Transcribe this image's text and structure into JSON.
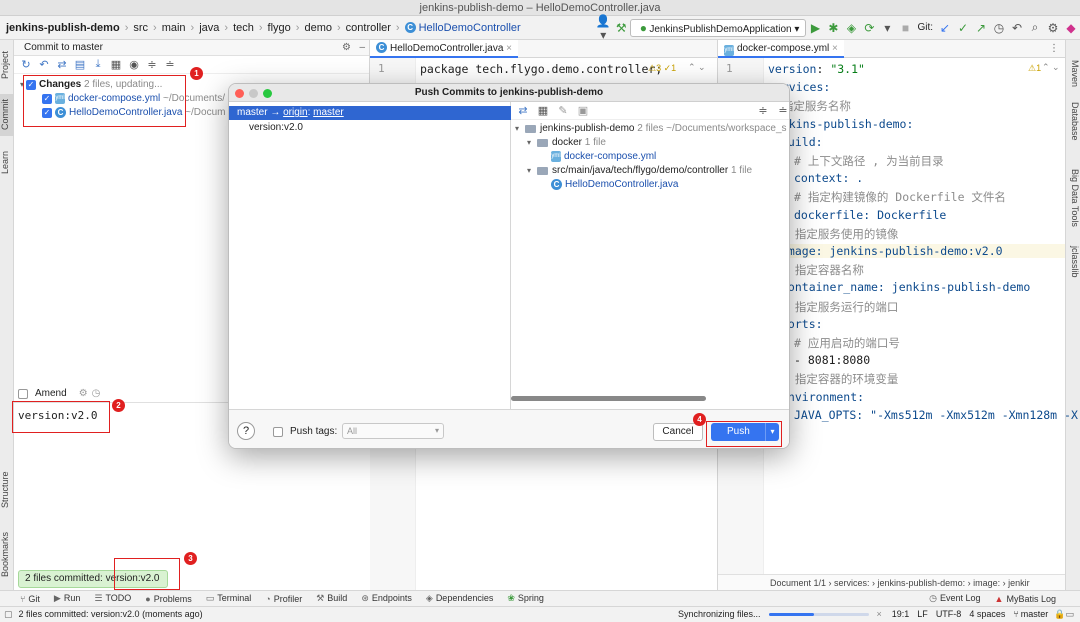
{
  "window": {
    "title": "jenkins-publish-demo – HelloDemoController.java"
  },
  "navbar": {
    "crumbs": [
      "jenkins-publish-demo",
      "src",
      "main",
      "java",
      "tech",
      "flygo",
      "demo",
      "controller",
      "HelloDemoController"
    ],
    "run_config": "JenkinsPublishDemoApplication",
    "git_label": "Git:"
  },
  "left_stripe": {
    "project": "Project",
    "commit": "Commit",
    "learn": "Learn",
    "structure": "Structure",
    "bookmarks": "Bookmarks"
  },
  "right_stripe": {
    "maven": "Maven",
    "database": "Database",
    "bigdata": "Big Data Tools",
    "jclasslib": "jclasslib"
  },
  "commit_panel": {
    "header": "Commit to master",
    "changes_label": "Changes",
    "changes_status": "2 files, updating...",
    "files": [
      {
        "name": "docker-compose.yml",
        "path": "~/Documents/"
      },
      {
        "name": "HelloDemoController.java",
        "path": "~/Docum"
      }
    ],
    "amend_label": "Amend",
    "message": "version:v2.0"
  },
  "annotations": [
    "1",
    "2",
    "3",
    "4"
  ],
  "editor1": {
    "tab": "HelloDemoController.java",
    "line_number": "1",
    "code": "package tech.flygo.demo.controller;",
    "warnings": "⚠3 ✓1"
  },
  "editor2": {
    "tab": "docker-compose.yml",
    "line_number": "1",
    "warnings": "⚠1",
    "lines": [
      {
        "k": "version",
        "v": "\"3.1\"",
        "type": "kv"
      },
      {
        "text": "services:",
        "type": "key",
        "indent": 0
      },
      {
        "text": "# 指定服务名称",
        "type": "cmt",
        "indent": 0
      },
      {
        "text": "jenkins-publish-demo:",
        "type": "key",
        "indent": 0
      },
      {
        "text": "build:",
        "type": "key",
        "indent": 1
      },
      {
        "text": "# 上下文路径 , 为当前目录",
        "type": "cmt",
        "indent": 2
      },
      {
        "text": "context: .",
        "type": "key",
        "indent": 2
      },
      {
        "text": "# 指定构建镜像的 Dockerfile 文件名",
        "type": "cmt",
        "indent": 2
      },
      {
        "text": "dockerfile: Dockerfile",
        "type": "key",
        "indent": 2
      },
      {
        "text": "# 指定服务使用的镜像",
        "type": "cmt",
        "indent": 1
      },
      {
        "text": "image: jenkins-publish-demo:v2.0",
        "type": "key",
        "indent": 1
      },
      {
        "text": "# 指定容器名称",
        "type": "cmt",
        "indent": 1
      },
      {
        "text": "container_name: jenkins-publish-demo",
        "type": "key",
        "indent": 1
      },
      {
        "text": "# 指定服务运行的端口",
        "type": "cmt",
        "indent": 1
      },
      {
        "text": "ports:",
        "type": "key",
        "indent": 1
      },
      {
        "text": "# 应用启动的端口号",
        "type": "cmt",
        "indent": 2
      },
      {
        "text": "- 8081:8080",
        "type": "plain",
        "indent": 2
      },
      {
        "text": "# 指定容器的环境变量",
        "type": "cmt",
        "indent": 1
      },
      {
        "text": "environment:",
        "type": "key",
        "indent": 1
      },
      {
        "text": "JAVA_OPTS: \"-Xms512m -Xmx512m -Xmn128m -X",
        "type": "key",
        "indent": 2
      }
    ],
    "breadcrumb": "Document 1/1  ›  services:  ›  jenkins-publish-demo:  ›  image:  ›  jenkir"
  },
  "dialog": {
    "title": "Push Commits to jenkins-publish-demo",
    "branch_row": {
      "local": "master",
      "arrow": "→",
      "remote": "origin",
      "colon": ":",
      "target": "master"
    },
    "commit": "version:v2.0",
    "tree": {
      "root": {
        "name": "jenkins-publish-demo",
        "meta": "2 files ~/Documents/workspace_s"
      },
      "folder1": {
        "name": "docker",
        "meta": "1 file"
      },
      "file1": "docker-compose.yml",
      "folder2": {
        "name": "src/main/java/tech/flygo/demo/controller",
        "meta": "1 file"
      },
      "file2": "HelloDemoController.java"
    },
    "help": "?",
    "push_tags_label": "Push tags:",
    "tags_value": "All",
    "cancel": "Cancel",
    "push": "Push"
  },
  "toast": {
    "text": "2 files committed: version:v2.0"
  },
  "bottom_tools": [
    "Git",
    "Run",
    "TODO",
    "Problems",
    "Terminal",
    "Profiler",
    "Build",
    "Endpoints",
    "Dependencies",
    "Spring"
  ],
  "bottom_right_tools": [
    "Event Log",
    "MyBatis Log"
  ],
  "statusbar": {
    "message": "2 files committed: version:v2.0 (moments ago)",
    "task": "Synchronizing files...",
    "progress": 0.45,
    "position": "19:1",
    "line_sep": "LF",
    "encoding": "UTF-8",
    "indent": "4 spaces",
    "branch": "master"
  }
}
